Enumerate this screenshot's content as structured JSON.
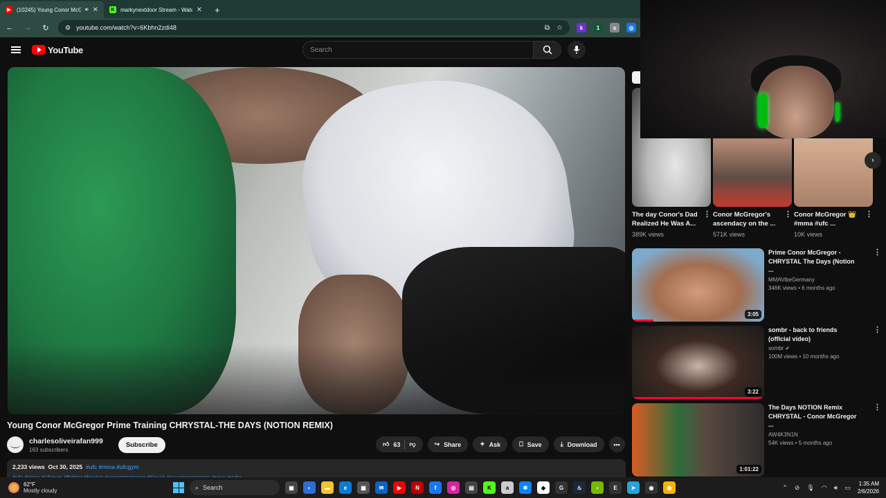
{
  "browser": {
    "tabs": [
      {
        "title": "(10245) Young Conor McGr",
        "active": true
      },
      {
        "title": "markynextdoor Stream - Watch",
        "active": false
      }
    ],
    "url": "youtube.com/watch?v=6Kbhn2zdl48"
  },
  "youtube": {
    "logo_text": "YouTube",
    "search_placeholder": "Search"
  },
  "video": {
    "title": "Young Conor McGregor Prime Training CHRYSTAL-THE DAYS (NOTION REMIX)",
    "channel": "charlesoliveirafan999",
    "subscribers": "163 subscribers",
    "subscribe_label": "Subscribe",
    "likes": "63",
    "actions": {
      "share": "Share",
      "ask": "Ask",
      "save": "Save",
      "download": "Download"
    },
    "description": {
      "views": "2,233 views",
      "date": "Oct 30, 2025",
      "tags": "#ufc #mma #ufcgym",
      "tags_line2": "#ufc #mma #ufcgym #fighter #boxing #conormcgregor #Конор #конормакгрегор #мма #юфс"
    }
  },
  "shorts": [
    {
      "title": "The day Conor's Dad Realized He Was A...",
      "views": "389K views"
    },
    {
      "title": "Conor McGregor's ascendacy on the ...",
      "views": "571K views"
    },
    {
      "title": "Conor McGregor 👑 #mma #ufc ...",
      "views": "10K views"
    }
  ],
  "recommendations": [
    {
      "title": "Prime Conor McGregor - CHRYSTAL The Days (Notion ...",
      "channel": "MMAVibeGermany",
      "meta": "346K views • 6 months ago",
      "duration": "3:05"
    },
    {
      "title": "sombr - back to friends (official video)",
      "channel": "sombr ✔",
      "meta": "100M views • 10 months ago",
      "duration": "3:22"
    },
    {
      "title": "The Days NOTION Remix CHRYSTAL - Conor McGregor ...",
      "channel": "AW4K3N1N",
      "meta": "54K views • 5 months ago",
      "duration": "1:01:22"
    }
  ],
  "taskbar": {
    "weather_temp": "62°F",
    "weather_desc": "Mostly cloudy",
    "search_label": "Search",
    "time": "1:35 AM",
    "date": "2/6/2026"
  }
}
